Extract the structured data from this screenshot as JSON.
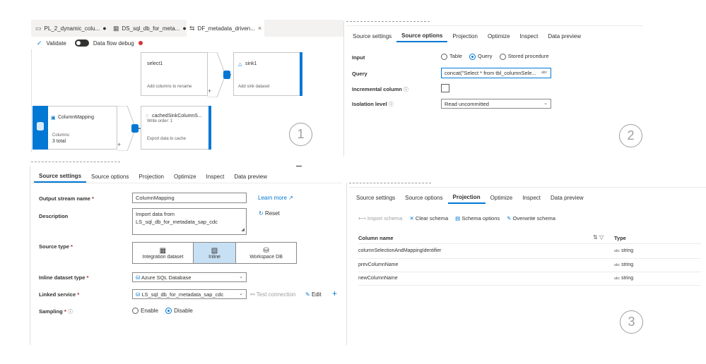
{
  "panel1": {
    "tabs": [
      {
        "icon": "pipeline-icon",
        "label": "PL_2_dynamic_colu...",
        "modified": "●"
      },
      {
        "icon": "table-icon",
        "label": "DS_sql_db_for_meta...",
        "modified": "●"
      },
      {
        "icon": "dataflow-icon",
        "label": "DF_metadata_driven...",
        "close": "×"
      }
    ],
    "toolbar": {
      "validate": "Validate",
      "debug": "Data flow debug"
    },
    "nodes": {
      "select1": {
        "title": "select1",
        "subtitle": "Add columns to rename"
      },
      "sink1": {
        "title": "sink1",
        "subtitle": "Add sink dataset"
      },
      "columnMapping": {
        "title": "ColumnMapping",
        "columns_label": "Columns:",
        "columns_value": "3 total"
      },
      "cachedSink": {
        "title": "cachedSinkColumnS...",
        "write_order": "Write order: 1",
        "subtitle": "Export data to cache"
      }
    },
    "plus": "+",
    "step": "1"
  },
  "panel2": {
    "tabs": [
      "Source settings",
      "Source options",
      "Projection",
      "Optimize",
      "Inspect",
      "Data preview"
    ],
    "selected_tab": "Source options",
    "input_label": "Input",
    "input_options": [
      "Table",
      "Query",
      "Stored procedure"
    ],
    "input_selected": "Query",
    "query_label": "Query",
    "query_value": "concat(\"Select * from tbl_columnSele...",
    "query_badge": "abc",
    "incremental_label": "Incremental column",
    "isolation_label": "Isolation level",
    "isolation_value": "Read uncommitted",
    "step": "2"
  },
  "panel4": {
    "tabs": [
      "Source settings",
      "Source options",
      "Projection",
      "Optimize",
      "Inspect",
      "Data preview"
    ],
    "selected_tab": "Source settings",
    "output_stream_label": "Output stream name",
    "output_stream_value": "ColumnMapping",
    "learn_more": "Learn more",
    "description_label": "Description",
    "description_value": "Import data from LS_sql_db_for_metadata_sap_cdc",
    "reset": "Reset",
    "source_type_label": "Source type",
    "source_types": [
      "Integration dataset",
      "Inline",
      "Workspace DB"
    ],
    "source_type_selected": "Inline",
    "inline_type_label": "Inline dataset type",
    "inline_type_value": "Azure SQL Database",
    "linked_service_label": "Linked service",
    "linked_service_value": "LS_sql_db_for_metadata_sap_cdc",
    "test_connection": "Test connection",
    "edit": "Edit",
    "sampling_label": "Sampling",
    "sampling_options": [
      "Enable",
      "Disable"
    ],
    "sampling_selected": "Disable",
    "required_mark": "*"
  },
  "panel3": {
    "tabs": [
      "Source settings",
      "Source options",
      "Projection",
      "Optimize",
      "Inspect",
      "Data preview"
    ],
    "selected_tab": "Projection",
    "toolbar": [
      "Import schema",
      "Clear schema",
      "Schema options",
      "Overwrite schema"
    ],
    "col_header": "Column name",
    "type_header": "Type",
    "rows": [
      {
        "name": "columnSelectionAndMappingIdentifier",
        "type": "string"
      },
      {
        "name": "prevColumnName",
        "type": "string"
      },
      {
        "name": "newColumnName",
        "type": "string"
      }
    ],
    "type_prefix": "abc",
    "step": "3"
  },
  "colors": {
    "accent": "#0078d4",
    "debug_dot": "#d13438",
    "required": "#a4262c"
  }
}
